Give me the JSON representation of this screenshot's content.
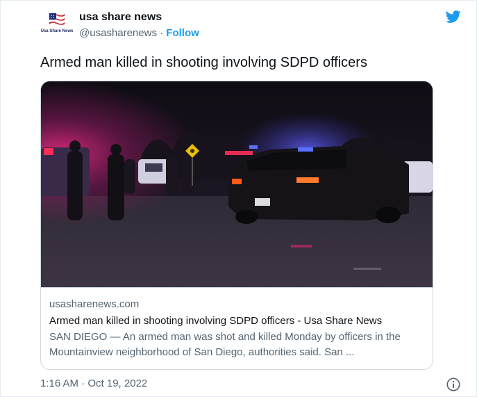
{
  "account": {
    "display_name": "usa share news",
    "handle": "@usasharenews",
    "separator": " · ",
    "follow_label": "Follow",
    "avatar_caption": "Usa Share News"
  },
  "tweet": {
    "text": "Armed man killed in shooting involving SDPD officers",
    "timestamp": "1:16 AM · Oct 19, 2022"
  },
  "card": {
    "domain": "usasharenews.com",
    "title": "Armed man killed in shooting involving SDPD officers - Usa Share News",
    "description": "SAN DIEGO — An armed man was shot and killed Monday by officers in the Mountainview neighborhood of San Diego, authorities said. San ..."
  },
  "icons": {
    "brand": "twitter-bird-icon",
    "info": "info-icon",
    "avatar": "us-flag-logo"
  },
  "colors": {
    "twitter_blue": "#1d9bf0",
    "text_primary": "#0f1419",
    "text_secondary": "#536471",
    "border": "#cfd9de"
  }
}
